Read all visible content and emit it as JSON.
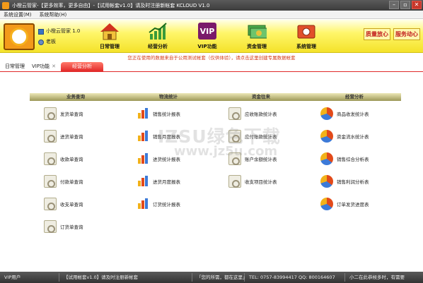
{
  "window": {
    "title": "小橙云管家-【更多效率，更多自由】-【试用帐套v1.0】请及时注册新帐套  KCLOUD V1.0",
    "buttons": [
      "–",
      "▫",
      "✕"
    ]
  },
  "menu": [
    "系统设置(M)",
    "系统帮助(H)"
  ],
  "toolbar": {
    "user_name": "小橙云管家 1.0",
    "user_role": "老板",
    "buttons": [
      {
        "label": "日常管理",
        "icon": "house-icon"
      },
      {
        "label": "经营分析",
        "icon": "chart-icon"
      },
      {
        "label": "VIP功能",
        "icon": "vip-icon"
      },
      {
        "label": "资金管理",
        "icon": "money-icon"
      },
      {
        "label": "系统管理",
        "icon": "system-icon"
      }
    ],
    "badges": [
      "质量放心",
      "服务动心"
    ]
  },
  "notice": "您正在使用的数据来自于公用测试帐套（仅供体验），请点击这里创建专属数据帐套",
  "tabs": [
    {
      "label": "日常管理",
      "closable": false,
      "active": false
    },
    {
      "label": "VIP功能",
      "closable": true,
      "active": false
    },
    {
      "label": "经营分析",
      "closable": true,
      "active": true
    }
  ],
  "sections": [
    {
      "title": "业务查询",
      "icon_type": "doc",
      "items": [
        "发货单查询",
        "进货单查询",
        "收款单查询",
        "付款单查询",
        "收支单查询",
        "订货单查询"
      ]
    },
    {
      "title": "物流统计",
      "icon_type": "bar",
      "items": [
        "销售统计报表",
        "销售月度报表",
        "进货统计报表",
        "进货月度报表",
        "订货统计报表"
      ]
    },
    {
      "title": "资金往来",
      "icon_type": "doc",
      "items": [
        "应收账款统计表",
        "应付账款统计表",
        "账户余额统计表",
        "收支项目统计表"
      ]
    },
    {
      "title": "经营分析",
      "icon_type": "pie",
      "items": [
        "商品收发统计表",
        "资金流水统计表",
        "销售综合分析表",
        "销售利润分析表",
        "订单发货进度表"
      ]
    }
  ],
  "watermark": {
    "line1": "IZSU绿色下载",
    "line2": "www.jz5u.com"
  },
  "status": [
    "VIP用户",
    "【试用帐套v1.0】请及时注册新帐套",
    "「您的所需，都在这里」",
    "TEL: 0757-83994417   QQ: 800164607",
    "小二在此恭候多时，有需要"
  ]
}
